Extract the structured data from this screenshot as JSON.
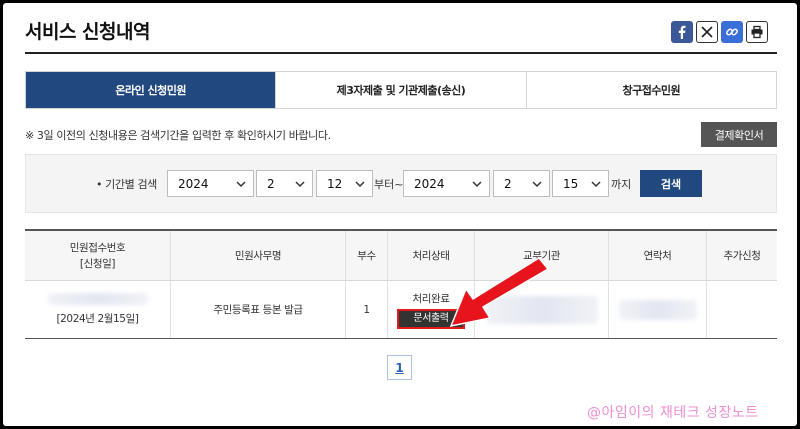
{
  "page": {
    "title": "서비스 신청내역"
  },
  "share_icons": [
    "facebook-icon",
    "x-icon",
    "link-icon",
    "print-icon"
  ],
  "tabs": [
    {
      "label": "온라인 신청민원",
      "active": true
    },
    {
      "label": "제3자제출 및 기관제출(송신)",
      "active": false
    },
    {
      "label": "창구접수민원",
      "active": false
    }
  ],
  "notice": "※ 3일 이전의 신청내용은 검색기간을 입력한 후 확인하시기 바랍니다.",
  "receipt_button": "결제확인서",
  "search": {
    "label": "• 기간별 검색",
    "from_year": "2024",
    "from_month": "2",
    "from_day": "12",
    "from_suffix": "부터~",
    "to_year": "2024",
    "to_month": "2",
    "to_day": "15",
    "to_suffix": "까지",
    "button": "검색"
  },
  "table": {
    "headers": {
      "receipt_no_line1": "민원접수번호",
      "receipt_no_line2": "[신청일]",
      "service_name": "민원사무명",
      "copies": "부수",
      "status": "처리상태",
      "issuing_agency": "교부기관",
      "contact": "연락처",
      "additional": "추가신청"
    },
    "rows": [
      {
        "date": "[2024년 2월15일]",
        "service_name": "주민등록표 등본 발급",
        "copies": "1",
        "status": "처리완료",
        "print_button": "문서출력"
      }
    ]
  },
  "pagination": {
    "current": "1"
  },
  "watermark": "@아임이의 재테크 성장노트",
  "colors": {
    "primary": "#21497f",
    "highlight": "#e0191b",
    "watermark": "#ef8ed1"
  }
}
